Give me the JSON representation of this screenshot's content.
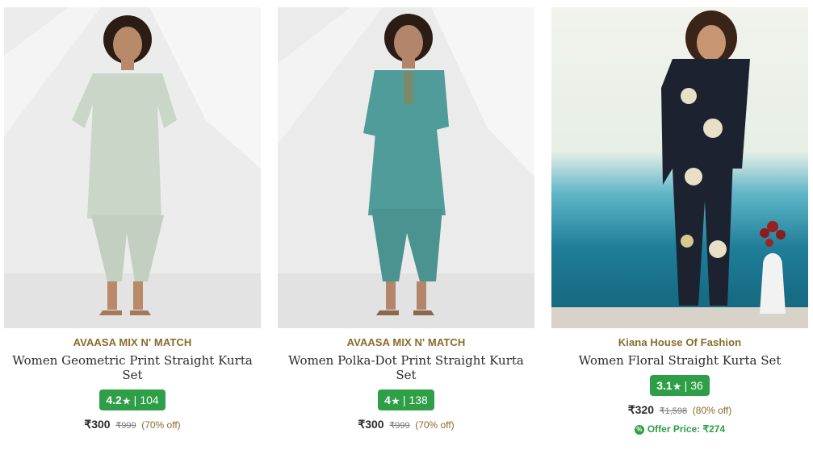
{
  "products": [
    {
      "brand": "AVAASA MIX N' MATCH",
      "title": "Women Geometric Print Straight Kurta Set",
      "rating": "4.2",
      "reviews": "104",
      "price": "₹300",
      "mrp": "₹999",
      "discount": "(70% off)",
      "image_icon": "woman-in-sage-kurta-set",
      "outfit_color": "#c9d6c8"
    },
    {
      "brand": "AVAASA MIX N' MATCH",
      "title": "Women Polka-Dot Print Straight Kurta Set",
      "rating": "4",
      "reviews": "138",
      "price": "₹300",
      "mrp": "₹999",
      "discount": "(70% off)",
      "image_icon": "woman-in-teal-kurta-set",
      "outfit_color": "#4f9c9a"
    },
    {
      "brand": "Kiana House Of Fashion",
      "title": "Women Floral Straight Kurta Set",
      "rating": "3.1",
      "reviews": "36",
      "price": "₹320",
      "mrp": "₹1,598",
      "discount": "(80% off)",
      "offer_label": "Offer Price: ₹274",
      "image_icon": "woman-in-navy-floral-kurta-set",
      "outfit_color": "#1c2230"
    }
  ],
  "colors": {
    "brand_text": "#8a6a2a",
    "rating_bg": "#2e9e47",
    "offer_text": "#2e9e47"
  },
  "rating_separator": "|",
  "star_glyph": "★",
  "offer_badge_glyph": "%"
}
